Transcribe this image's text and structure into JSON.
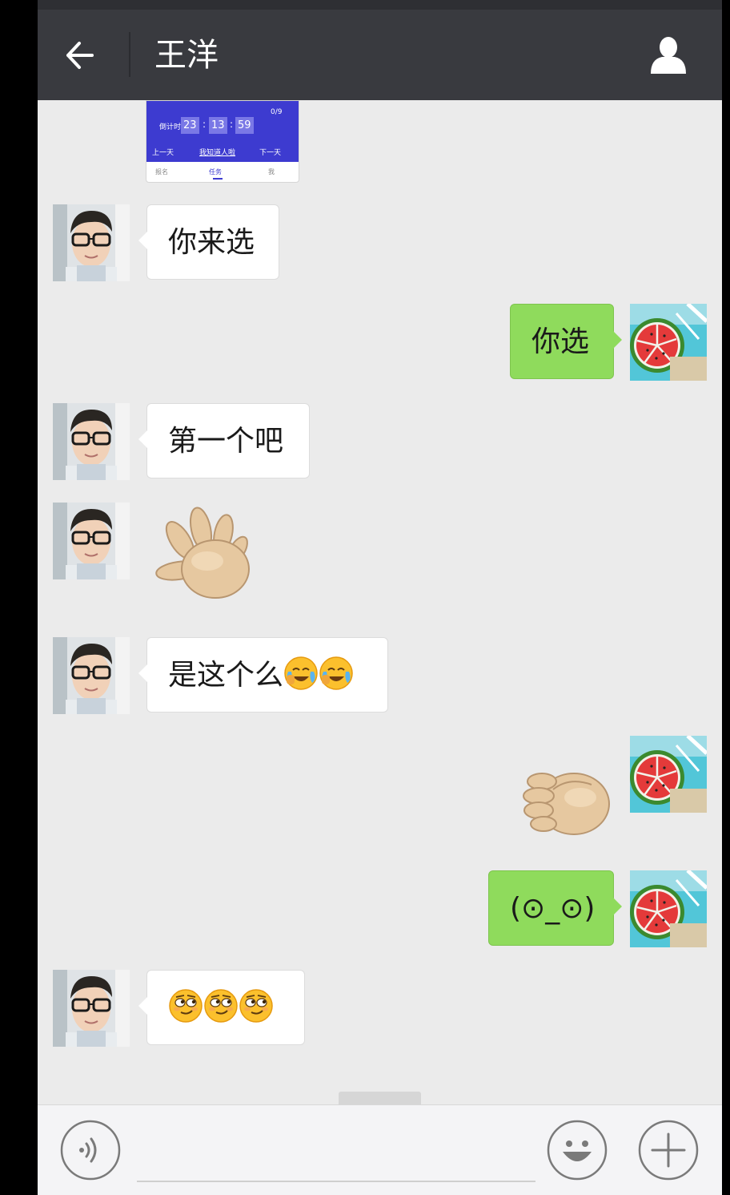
{
  "header": {
    "title": "王洋"
  },
  "shared_card": {
    "countdown_label": "倒计时",
    "hours": "23",
    "minutes": "13",
    "seconds": "59",
    "counter": "0/9",
    "prev_day": "上一天",
    "center_link": "我知道人啦",
    "next_day": "下一天",
    "tabs": [
      "报名",
      "任务",
      "我"
    ]
  },
  "messages": [
    {
      "sender": "contact",
      "type": "text",
      "text": "你来选"
    },
    {
      "sender": "me",
      "type": "text",
      "text": "你选"
    },
    {
      "sender": "contact",
      "type": "text",
      "text": "第一个吧"
    },
    {
      "sender": "contact",
      "type": "sticker",
      "sticker": "open-hand-paper"
    },
    {
      "sender": "contact",
      "type": "text",
      "text": "是这个么",
      "emojis": [
        "face-with-tears",
        "face-with-tears"
      ]
    },
    {
      "sender": "me",
      "type": "sticker",
      "sticker": "fist-rock"
    },
    {
      "sender": "me",
      "type": "text",
      "text": "(⊙_⊙)"
    },
    {
      "sender": "contact",
      "type": "emoji",
      "emojis": [
        "smirk-face",
        "smirk-face",
        "smirk-face"
      ]
    }
  ],
  "input": {
    "placeholder": ""
  },
  "colors": {
    "titlebar": "#393a3f",
    "chat_background": "#ebebeb",
    "outgoing_bubble": "#8fdb5c",
    "incoming_bubble": "#ffffff"
  },
  "icons": {
    "back": "arrow-left-icon",
    "profile": "person-icon",
    "voice": "voice-icon",
    "emoji": "smiley-icon",
    "more": "plus-icon"
  }
}
